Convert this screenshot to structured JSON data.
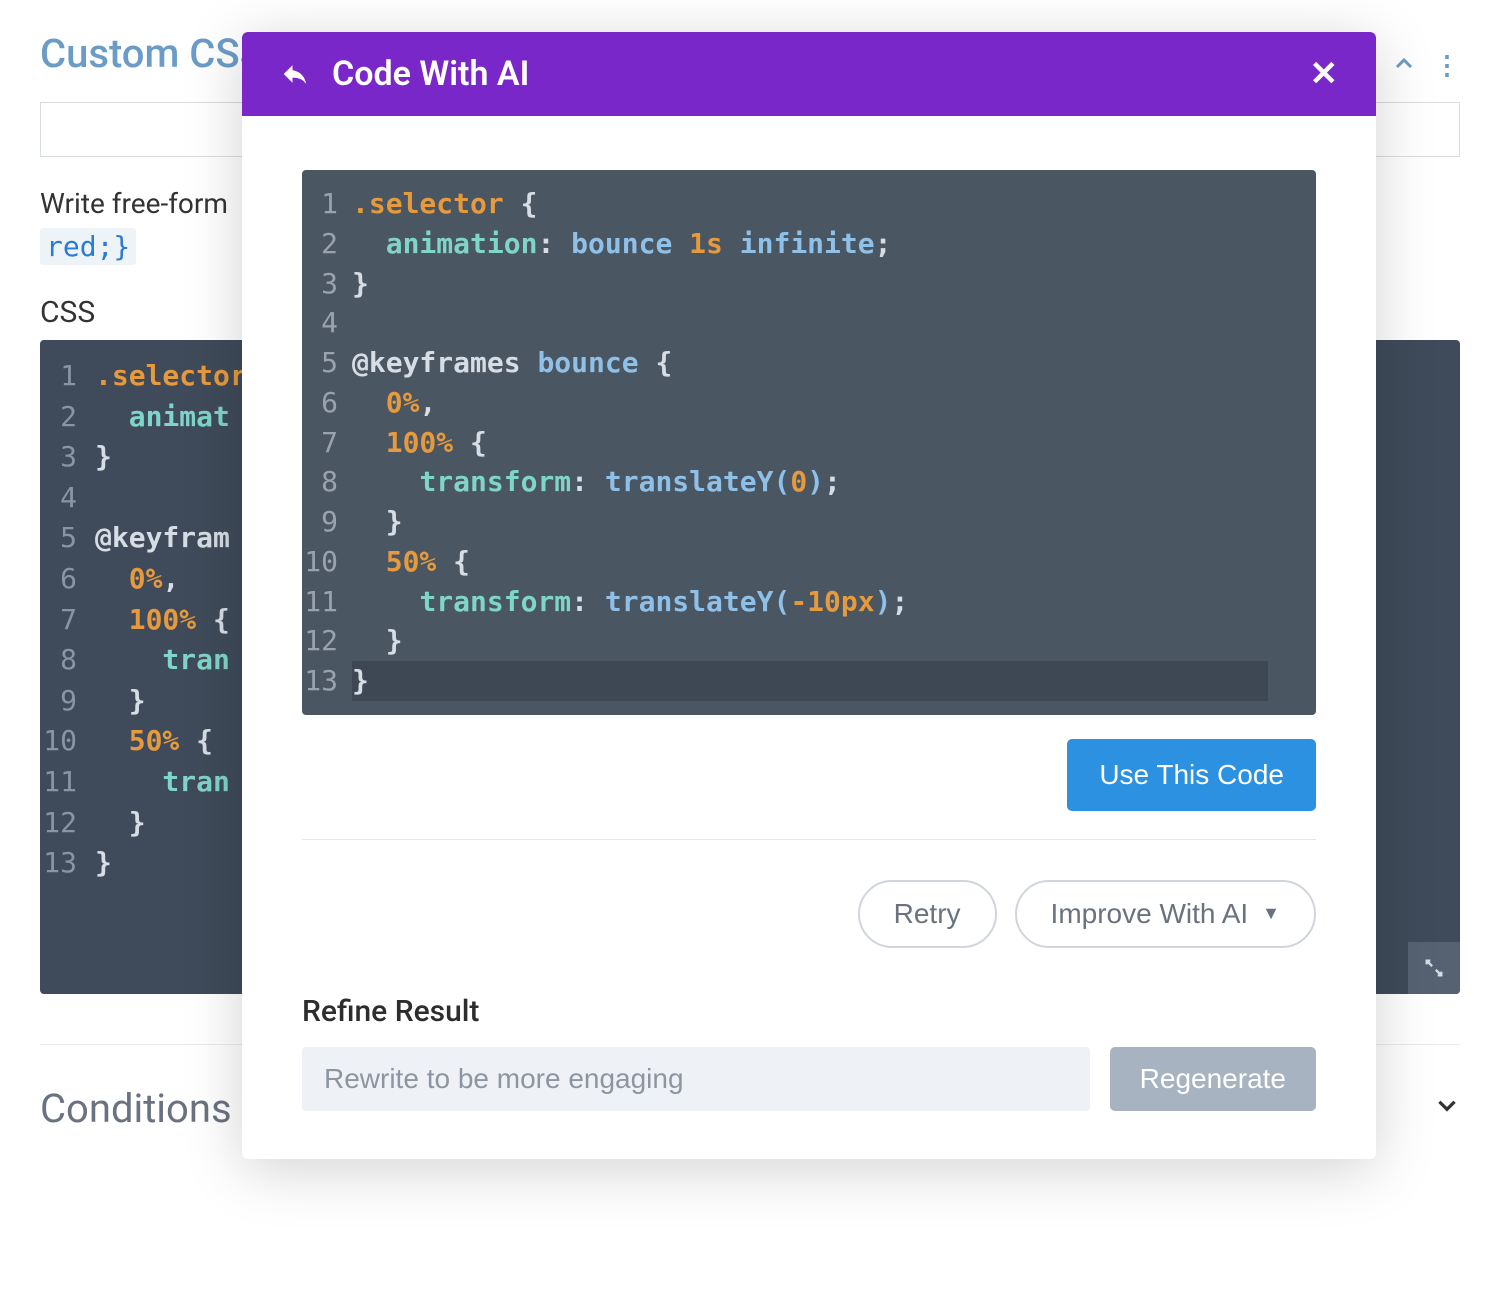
{
  "background": {
    "section_title": "Custom CSS",
    "hint_text": "Write free-form",
    "code_pill": "red;}",
    "css_label": "CSS",
    "conditions_title": "Conditions",
    "code_lines": [
      {
        "n": "1",
        "tokens": [
          {
            "cls": "c-sel",
            "t": ".selector"
          }
        ]
      },
      {
        "n": "2",
        "tokens": [
          {
            "cls": "c-prop",
            "t": "  animat"
          }
        ]
      },
      {
        "n": "3",
        "tokens": [
          {
            "cls": "c-punc",
            "t": "}"
          }
        ]
      },
      {
        "n": "4",
        "tokens": []
      },
      {
        "n": "5",
        "tokens": [
          {
            "cls": "c-punc",
            "t": "@keyfram"
          }
        ]
      },
      {
        "n": "6",
        "tokens": [
          {
            "cls": "c-num",
            "t": "  0%"
          },
          {
            "cls": "c-punc",
            "t": ","
          }
        ]
      },
      {
        "n": "7",
        "tokens": [
          {
            "cls": "c-num",
            "t": "  100%"
          },
          {
            "cls": "c-punc",
            "t": " {"
          }
        ]
      },
      {
        "n": "8",
        "tokens": [
          {
            "cls": "c-prop",
            "t": "    tran"
          }
        ]
      },
      {
        "n": "9",
        "tokens": [
          {
            "cls": "c-punc",
            "t": "  }"
          }
        ]
      },
      {
        "n": "10",
        "tokens": [
          {
            "cls": "c-num",
            "t": "  50%"
          },
          {
            "cls": "c-punc",
            "t": " {"
          }
        ]
      },
      {
        "n": "11",
        "tokens": [
          {
            "cls": "c-prop",
            "t": "    tran"
          }
        ]
      },
      {
        "n": "12",
        "tokens": [
          {
            "cls": "c-punc",
            "t": "  }"
          }
        ]
      },
      {
        "n": "13",
        "tokens": [
          {
            "cls": "c-punc",
            "t": "}"
          }
        ]
      }
    ]
  },
  "modal": {
    "title": "Code With AI",
    "use_code_label": "Use This Code",
    "retry_label": "Retry",
    "improve_label": "Improve With AI",
    "refine_label": "Refine Result",
    "refine_placeholder": "Rewrite to be more engaging",
    "regenerate_label": "Regenerate",
    "code_lines": [
      {
        "n": "1",
        "hl": false,
        "tokens": [
          {
            "cls": "mc-sel",
            "t": ".selector"
          },
          {
            "cls": "mc-punc",
            "t": " {"
          }
        ]
      },
      {
        "n": "2",
        "hl": false,
        "tokens": [
          {
            "cls": "mc-anim",
            "t": "  animation"
          },
          {
            "cls": "mc-punc",
            "t": ": "
          },
          {
            "cls": "mc-val",
            "t": "bounce "
          },
          {
            "cls": "mc-num",
            "t": "1s"
          },
          {
            "cls": "mc-val",
            "t": " infinite"
          },
          {
            "cls": "mc-punc",
            "t": ";"
          }
        ]
      },
      {
        "n": "3",
        "hl": false,
        "tokens": [
          {
            "cls": "mc-punc",
            "t": "}"
          }
        ]
      },
      {
        "n": "4",
        "hl": false,
        "tokens": []
      },
      {
        "n": "5",
        "hl": false,
        "tokens": [
          {
            "cls": "mc-keyword",
            "t": "@keyframes "
          },
          {
            "cls": "mc-val",
            "t": "bounce"
          },
          {
            "cls": "mc-punc",
            "t": " {"
          }
        ]
      },
      {
        "n": "6",
        "hl": false,
        "tokens": [
          {
            "cls": "mc-num",
            "t": "  0%"
          },
          {
            "cls": "mc-punc",
            "t": ","
          }
        ]
      },
      {
        "n": "7",
        "hl": false,
        "tokens": [
          {
            "cls": "mc-num",
            "t": "  100%"
          },
          {
            "cls": "mc-punc",
            "t": " {"
          }
        ]
      },
      {
        "n": "8",
        "hl": false,
        "tokens": [
          {
            "cls": "mc-punc",
            "t": "    "
          },
          {
            "cls": "mc-anim",
            "t": "transform"
          },
          {
            "cls": "mc-punc",
            "t": ": "
          },
          {
            "cls": "mc-func",
            "t": "translateY"
          },
          {
            "cls": "mc-paren",
            "t": "("
          },
          {
            "cls": "mc-num",
            "t": "0"
          },
          {
            "cls": "mc-paren",
            "t": ")"
          },
          {
            "cls": "mc-punc",
            "t": ";"
          }
        ]
      },
      {
        "n": "9",
        "hl": false,
        "tokens": [
          {
            "cls": "mc-punc",
            "t": "  }"
          }
        ]
      },
      {
        "n": "10",
        "hl": false,
        "tokens": [
          {
            "cls": "mc-num",
            "t": "  50%"
          },
          {
            "cls": "mc-punc",
            "t": " {"
          }
        ]
      },
      {
        "n": "11",
        "hl": false,
        "tokens": [
          {
            "cls": "mc-punc",
            "t": "    "
          },
          {
            "cls": "mc-anim",
            "t": "transform"
          },
          {
            "cls": "mc-punc",
            "t": ": "
          },
          {
            "cls": "mc-func",
            "t": "translateY"
          },
          {
            "cls": "mc-paren",
            "t": "("
          },
          {
            "cls": "mc-num",
            "t": "-10px"
          },
          {
            "cls": "mc-paren",
            "t": ")"
          },
          {
            "cls": "mc-punc",
            "t": ";"
          }
        ]
      },
      {
        "n": "12",
        "hl": false,
        "tokens": [
          {
            "cls": "mc-punc",
            "t": "  }"
          }
        ]
      },
      {
        "n": "13",
        "hl": true,
        "tokens": [
          {
            "cls": "mc-punc",
            "t": "}"
          }
        ]
      }
    ]
  }
}
